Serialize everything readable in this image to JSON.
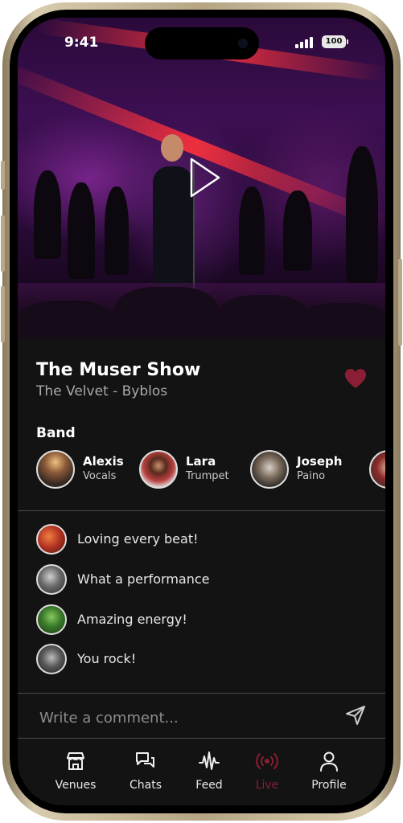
{
  "status_bar": {
    "time": "9:41",
    "battery": "100"
  },
  "show": {
    "title": "The Muser Show",
    "venue": "The Velvet - Byblos"
  },
  "band": {
    "heading": "Band",
    "members": [
      {
        "name": "Alexis",
        "role": "Vocals"
      },
      {
        "name": "Lara",
        "role": "Trumpet"
      },
      {
        "name": "Joseph",
        "role": "Paino"
      }
    ]
  },
  "comments": [
    {
      "text": "Loving every beat!"
    },
    {
      "text": "What a performance"
    },
    {
      "text": "Amazing energy!"
    },
    {
      "text": "You rock!"
    }
  ],
  "composer": {
    "placeholder": "Write a comment..."
  },
  "tabs": [
    {
      "label": "Venues",
      "icon": "store-icon"
    },
    {
      "label": "Chats",
      "icon": "chat-bubbles-icon"
    },
    {
      "label": "Feed",
      "icon": "waveform-icon"
    },
    {
      "label": "Live",
      "icon": "broadcast-icon",
      "active": true
    },
    {
      "label": "Profile",
      "icon": "user-icon"
    }
  ],
  "colors": {
    "accent": "#8b1e35",
    "background": "#131313",
    "text_secondary": "#a9a9a9"
  }
}
